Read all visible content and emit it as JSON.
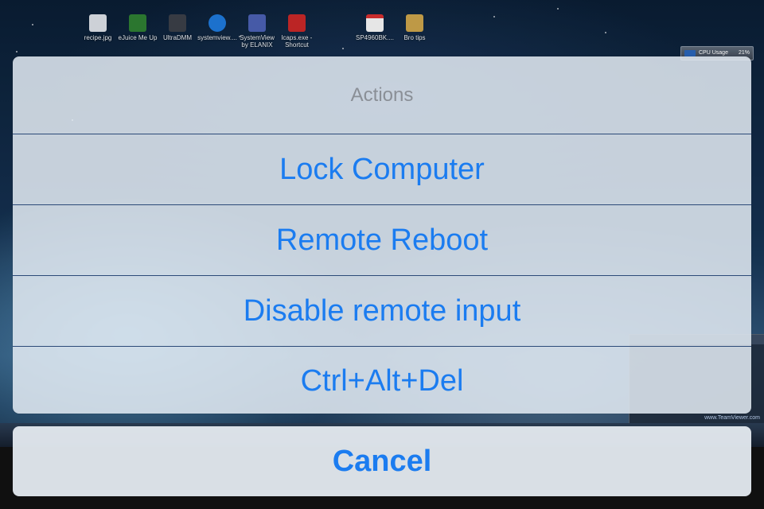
{
  "desktop": {
    "icons": [
      {
        "label": "recipe.jpg",
        "icon": "image-file-icon",
        "color": "#d9dde3"
      },
      {
        "label": "eJuice Me Up",
        "icon": "app-shortcut-icon",
        "color": "#2e7d32"
      },
      {
        "label": "UltraDMM",
        "icon": "app-shortcut-icon",
        "color": "#3a3f47"
      },
      {
        "label": "systemview....",
        "icon": "app-shortcut-icon",
        "color": "#1e78d8"
      },
      {
        "label": "SystemView\nby ELANIX",
        "icon": "app-shortcut-icon",
        "color": "#4a5fb0"
      },
      {
        "label": "lcaps.exe -\nShortcut",
        "icon": "app-shortcut-icon",
        "color": "#c62828"
      },
      {
        "label": "SP4960BK....",
        "icon": "pdf-file-icon",
        "color": "#d32f2f"
      },
      {
        "label": "Bro tips",
        "icon": "folder-icon",
        "color": "#c9a24a"
      }
    ],
    "cpu_widget": {
      "label": "CPU Usage",
      "value": "21%"
    },
    "teamviewer_text": "www.TeamViewer.com"
  },
  "action_sheet": {
    "title": "Actions",
    "actions": [
      {
        "label": "Lock Computer"
      },
      {
        "label": "Remote Reboot"
      },
      {
        "label": "Disable remote input"
      },
      {
        "label": "Ctrl+Alt+Del"
      }
    ],
    "cancel_label": "Cancel"
  },
  "colors": {
    "accent": "#1b7cf0",
    "title": "#8a8f96",
    "separator": "#2c4a78"
  }
}
